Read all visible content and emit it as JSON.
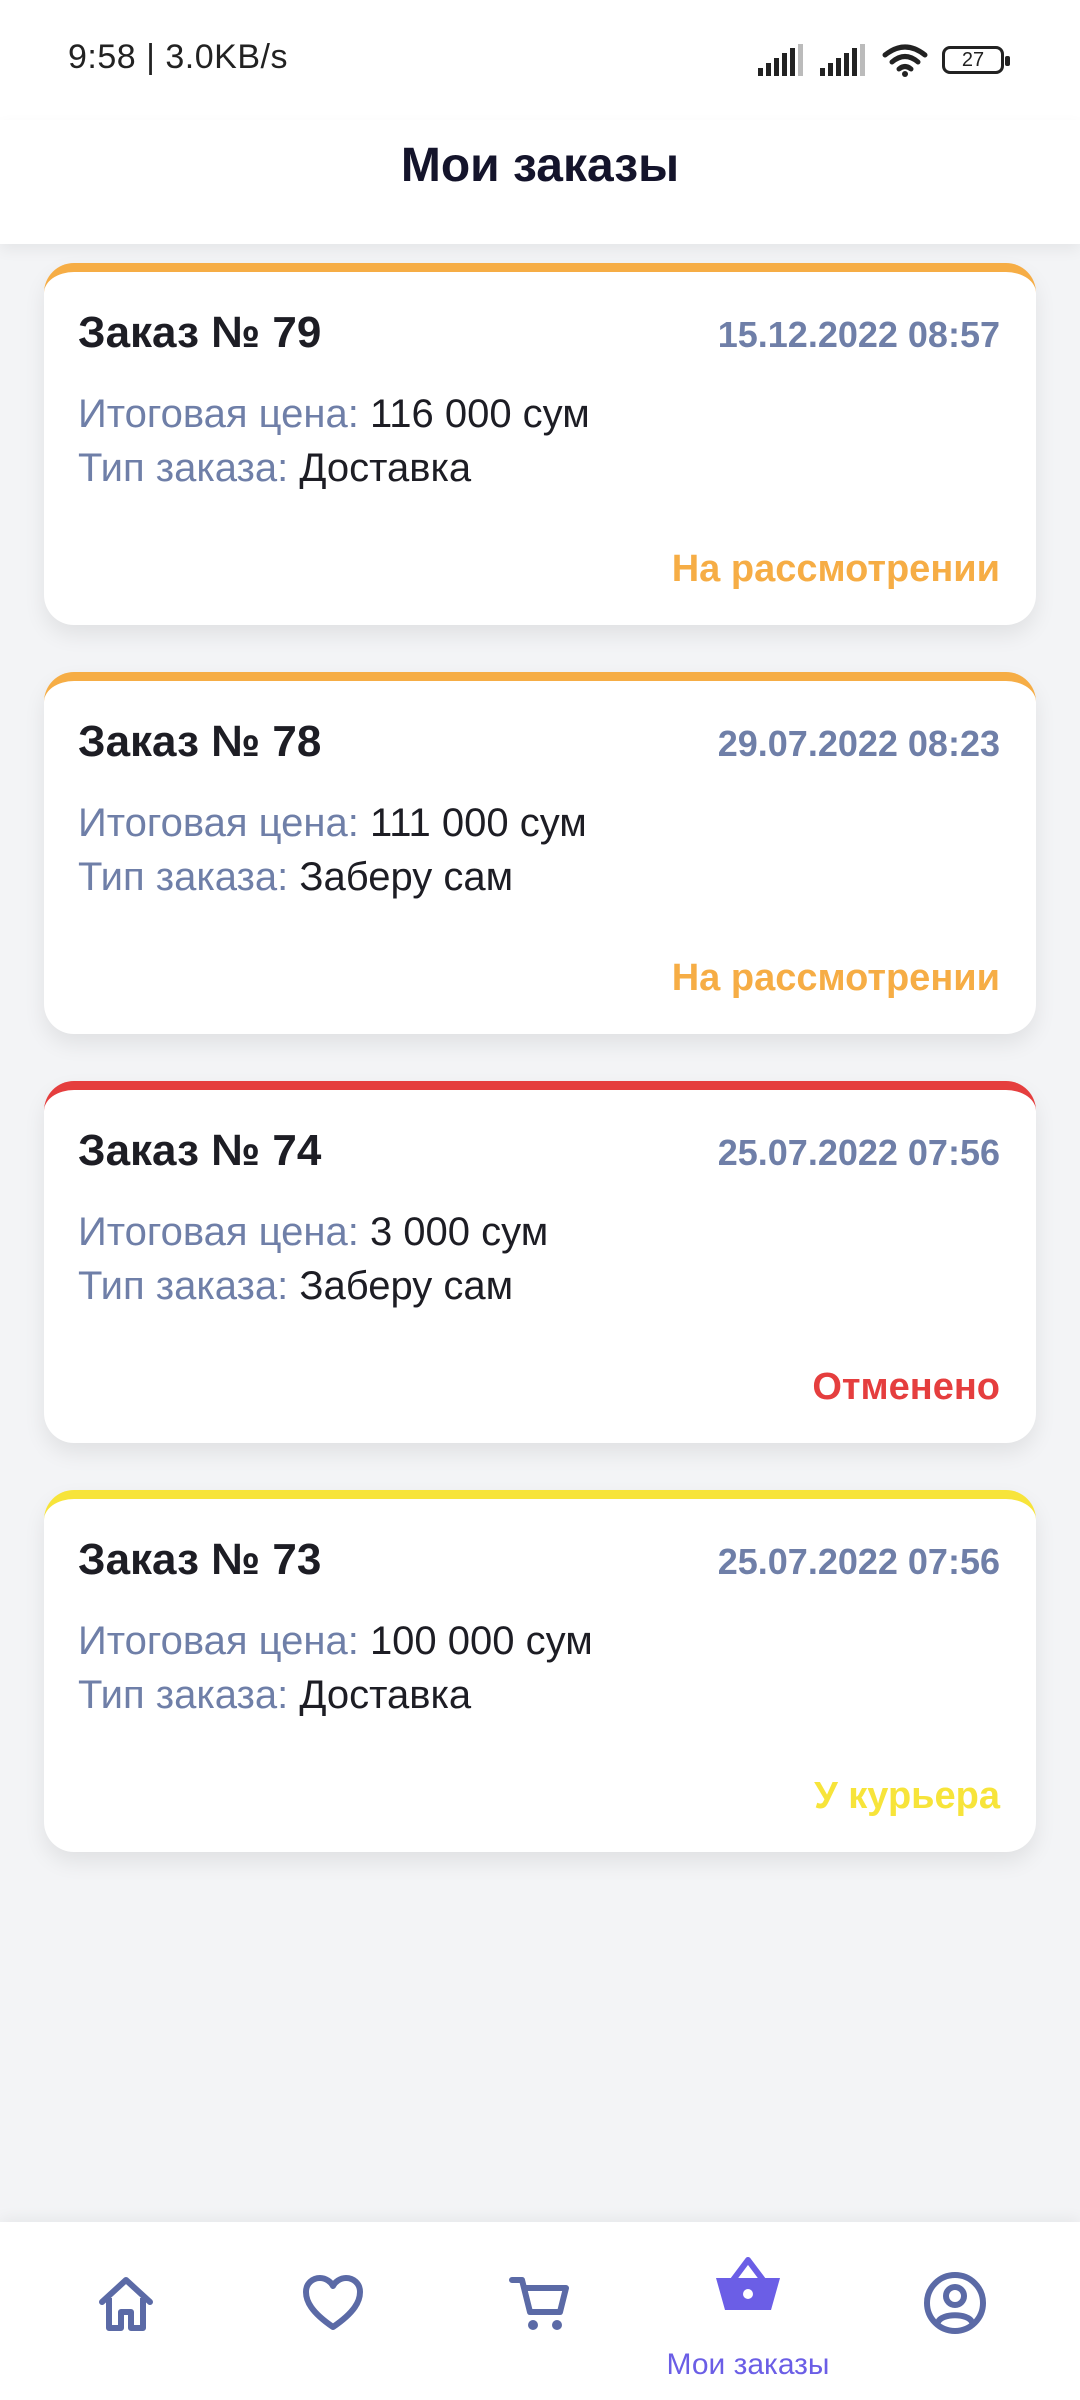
{
  "status_bar": {
    "time": "9:58 | 3.0KB/s",
    "battery": "27"
  },
  "header": {
    "title": "Мои заказы"
  },
  "labels": {
    "price": "Итоговая цена:",
    "type": "Тип заказа:"
  },
  "orders": [
    {
      "title": "Заказ № 79",
      "date": "15.12.2022 08:57",
      "price": "116 000 сум",
      "type": "Доставка",
      "status": "На рассмотрении",
      "color": "#f6ad45"
    },
    {
      "title": "Заказ № 78",
      "date": "29.07.2022 08:23",
      "price": "111 000 сум",
      "type": "Заберу сам",
      "status": "На рассмотрении",
      "color": "#f6ad45"
    },
    {
      "title": "Заказ № 74",
      "date": "25.07.2022 07:56",
      "price": "3 000 сум",
      "type": "Заберу сам",
      "status": "Отменено",
      "color": "#e53e3e"
    },
    {
      "title": "Заказ № 73",
      "date": "25.07.2022 07:56",
      "price": "100 000 сум",
      "type": "Доставка",
      "status": "У курьера",
      "color": "#f7e43a"
    }
  ],
  "nav": {
    "items": [
      {
        "icon": "home-icon",
        "label": ""
      },
      {
        "icon": "heart-icon",
        "label": ""
      },
      {
        "icon": "cart-icon",
        "label": ""
      },
      {
        "icon": "basket-icon",
        "label": "Мои заказы",
        "active": true
      },
      {
        "icon": "profile-icon",
        "label": ""
      }
    ],
    "inactive_color": "#5b6aa6",
    "active_color": "#6b5ee6"
  }
}
